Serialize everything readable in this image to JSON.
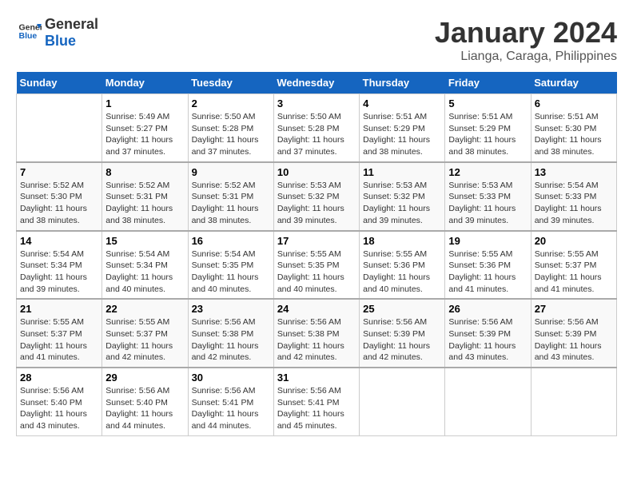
{
  "logo": {
    "line1": "General",
    "line2": "Blue"
  },
  "title": "January 2024",
  "subtitle": "Lianga, Caraga, Philippines",
  "days_header": [
    "Sunday",
    "Monday",
    "Tuesday",
    "Wednesday",
    "Thursday",
    "Friday",
    "Saturday"
  ],
  "weeks": [
    [
      {
        "num": "",
        "info": ""
      },
      {
        "num": "1",
        "info": "Sunrise: 5:49 AM\nSunset: 5:27 PM\nDaylight: 11 hours\nand 37 minutes."
      },
      {
        "num": "2",
        "info": "Sunrise: 5:50 AM\nSunset: 5:28 PM\nDaylight: 11 hours\nand 37 minutes."
      },
      {
        "num": "3",
        "info": "Sunrise: 5:50 AM\nSunset: 5:28 PM\nDaylight: 11 hours\nand 37 minutes."
      },
      {
        "num": "4",
        "info": "Sunrise: 5:51 AM\nSunset: 5:29 PM\nDaylight: 11 hours\nand 38 minutes."
      },
      {
        "num": "5",
        "info": "Sunrise: 5:51 AM\nSunset: 5:29 PM\nDaylight: 11 hours\nand 38 minutes."
      },
      {
        "num": "6",
        "info": "Sunrise: 5:51 AM\nSunset: 5:30 PM\nDaylight: 11 hours\nand 38 minutes."
      }
    ],
    [
      {
        "num": "7",
        "info": "Sunrise: 5:52 AM\nSunset: 5:30 PM\nDaylight: 11 hours\nand 38 minutes."
      },
      {
        "num": "8",
        "info": "Sunrise: 5:52 AM\nSunset: 5:31 PM\nDaylight: 11 hours\nand 38 minutes."
      },
      {
        "num": "9",
        "info": "Sunrise: 5:52 AM\nSunset: 5:31 PM\nDaylight: 11 hours\nand 38 minutes."
      },
      {
        "num": "10",
        "info": "Sunrise: 5:53 AM\nSunset: 5:32 PM\nDaylight: 11 hours\nand 39 minutes."
      },
      {
        "num": "11",
        "info": "Sunrise: 5:53 AM\nSunset: 5:32 PM\nDaylight: 11 hours\nand 39 minutes."
      },
      {
        "num": "12",
        "info": "Sunrise: 5:53 AM\nSunset: 5:33 PM\nDaylight: 11 hours\nand 39 minutes."
      },
      {
        "num": "13",
        "info": "Sunrise: 5:54 AM\nSunset: 5:33 PM\nDaylight: 11 hours\nand 39 minutes."
      }
    ],
    [
      {
        "num": "14",
        "info": "Sunrise: 5:54 AM\nSunset: 5:34 PM\nDaylight: 11 hours\nand 39 minutes."
      },
      {
        "num": "15",
        "info": "Sunrise: 5:54 AM\nSunset: 5:34 PM\nDaylight: 11 hours\nand 40 minutes."
      },
      {
        "num": "16",
        "info": "Sunrise: 5:54 AM\nSunset: 5:35 PM\nDaylight: 11 hours\nand 40 minutes."
      },
      {
        "num": "17",
        "info": "Sunrise: 5:55 AM\nSunset: 5:35 PM\nDaylight: 11 hours\nand 40 minutes."
      },
      {
        "num": "18",
        "info": "Sunrise: 5:55 AM\nSunset: 5:36 PM\nDaylight: 11 hours\nand 40 minutes."
      },
      {
        "num": "19",
        "info": "Sunrise: 5:55 AM\nSunset: 5:36 PM\nDaylight: 11 hours\nand 41 minutes."
      },
      {
        "num": "20",
        "info": "Sunrise: 5:55 AM\nSunset: 5:37 PM\nDaylight: 11 hours\nand 41 minutes."
      }
    ],
    [
      {
        "num": "21",
        "info": "Sunrise: 5:55 AM\nSunset: 5:37 PM\nDaylight: 11 hours\nand 41 minutes."
      },
      {
        "num": "22",
        "info": "Sunrise: 5:55 AM\nSunset: 5:37 PM\nDaylight: 11 hours\nand 42 minutes."
      },
      {
        "num": "23",
        "info": "Sunrise: 5:56 AM\nSunset: 5:38 PM\nDaylight: 11 hours\nand 42 minutes."
      },
      {
        "num": "24",
        "info": "Sunrise: 5:56 AM\nSunset: 5:38 PM\nDaylight: 11 hours\nand 42 minutes."
      },
      {
        "num": "25",
        "info": "Sunrise: 5:56 AM\nSunset: 5:39 PM\nDaylight: 11 hours\nand 42 minutes."
      },
      {
        "num": "26",
        "info": "Sunrise: 5:56 AM\nSunset: 5:39 PM\nDaylight: 11 hours\nand 43 minutes."
      },
      {
        "num": "27",
        "info": "Sunrise: 5:56 AM\nSunset: 5:39 PM\nDaylight: 11 hours\nand 43 minutes."
      }
    ],
    [
      {
        "num": "28",
        "info": "Sunrise: 5:56 AM\nSunset: 5:40 PM\nDaylight: 11 hours\nand 43 minutes."
      },
      {
        "num": "29",
        "info": "Sunrise: 5:56 AM\nSunset: 5:40 PM\nDaylight: 11 hours\nand 44 minutes."
      },
      {
        "num": "30",
        "info": "Sunrise: 5:56 AM\nSunset: 5:41 PM\nDaylight: 11 hours\nand 44 minutes."
      },
      {
        "num": "31",
        "info": "Sunrise: 5:56 AM\nSunset: 5:41 PM\nDaylight: 11 hours\nand 45 minutes."
      },
      {
        "num": "",
        "info": ""
      },
      {
        "num": "",
        "info": ""
      },
      {
        "num": "",
        "info": ""
      }
    ]
  ]
}
